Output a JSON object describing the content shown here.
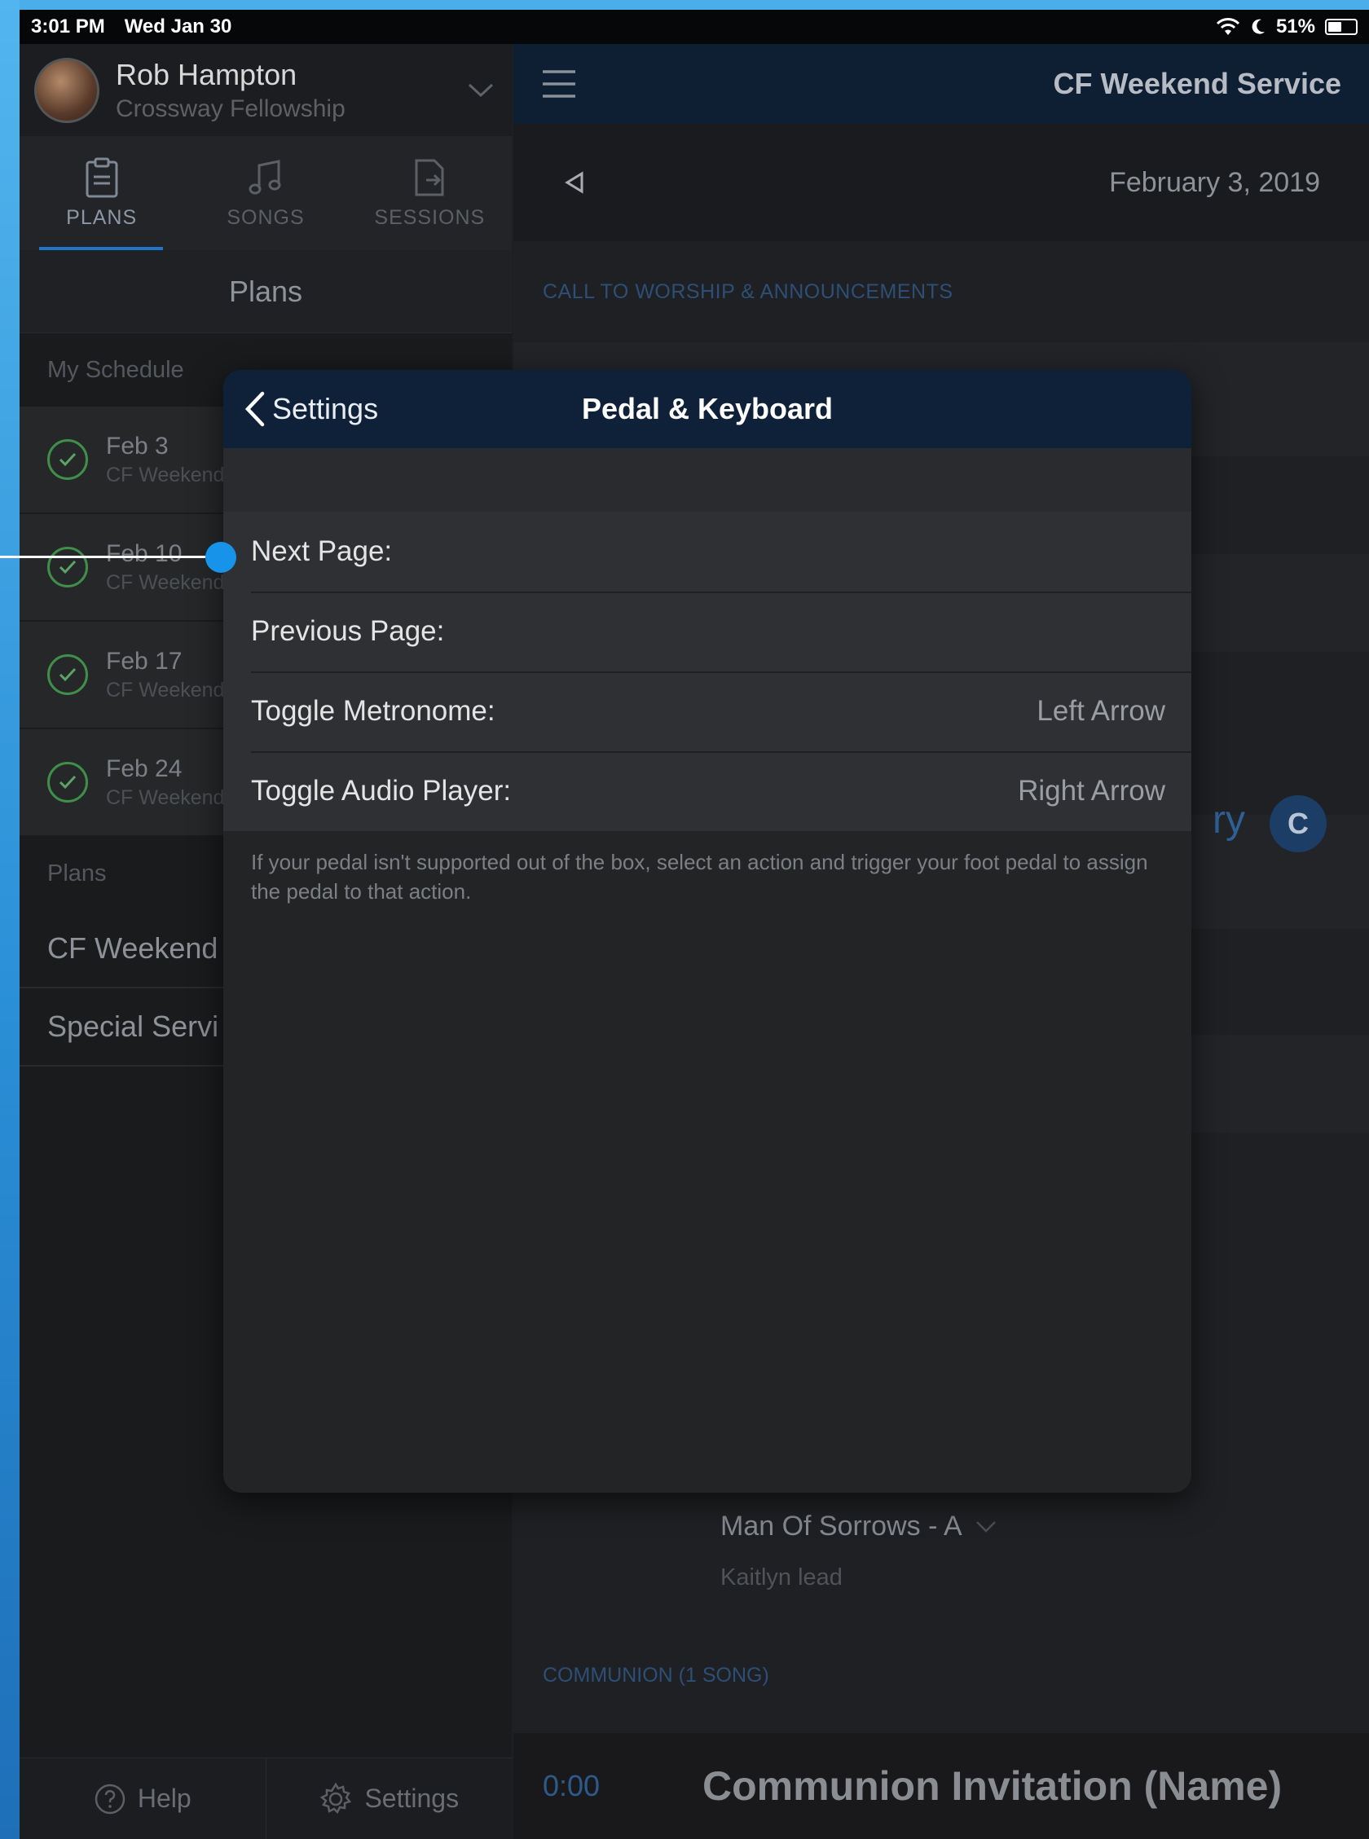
{
  "status_bar": {
    "time": "3:01 PM",
    "date": "Wed Jan 30",
    "battery": "51%",
    "battery_level": 0.51
  },
  "sidebar": {
    "profile": {
      "name": "Rob Hampton",
      "organization": "Crossway Fellowship"
    },
    "tabs": [
      {
        "label": "PLANS",
        "icon": "clipboard-icon",
        "active": true
      },
      {
        "label": "SONGS",
        "icon": "music-note-icon",
        "active": false
      },
      {
        "label": "SESSIONS",
        "icon": "session-icon",
        "active": false
      }
    ],
    "header": "Plans",
    "schedule_label": "My Schedule",
    "schedule": [
      {
        "date": "Feb 3",
        "subtitle": "CF Weekend"
      },
      {
        "date": "Feb 10",
        "subtitle": "CF Weekend"
      },
      {
        "date": "Feb 17",
        "subtitle": "CF Weekend"
      },
      {
        "date": "Feb 24",
        "subtitle": "CF Weekend"
      }
    ],
    "plans_label": "Plans",
    "plans": [
      {
        "label": "CF Weekend"
      },
      {
        "label": "Special Servi"
      }
    ],
    "footer": {
      "help": "Help",
      "settings": "Settings"
    }
  },
  "main": {
    "title": "CF Weekend Service",
    "date": "February 3, 2019",
    "section_1": "CALL TO WORSHIP & ANNOUNCEMENTS",
    "peek_text": "ry",
    "peek_badge": "C",
    "song_title": "Man Of Sorrows - A",
    "song_note": "Kaitlyn lead",
    "section_2": "COMMUNION (1 SONG)",
    "song_row": {
      "time": "0:00",
      "name": "Communion Invitation (Name)"
    }
  },
  "modal": {
    "back_label": "Settings",
    "title": "Pedal & Keyboard",
    "rows": [
      {
        "label": "Next Page:",
        "value": ""
      },
      {
        "label": "Previous Page:",
        "value": ""
      },
      {
        "label": "Toggle Metronome:",
        "value": "Left Arrow"
      },
      {
        "label": "Toggle Audio Player:",
        "value": "Right Arrow"
      }
    ],
    "note": "If your pedal isn't supported out of the box, select an action and trigger your foot pedal to assign the pedal to that action."
  },
  "colors": {
    "accent": "#1e77c8",
    "topbar": "#0e1e33",
    "check": "#3f8f4a",
    "pointer": "#1793ea"
  }
}
